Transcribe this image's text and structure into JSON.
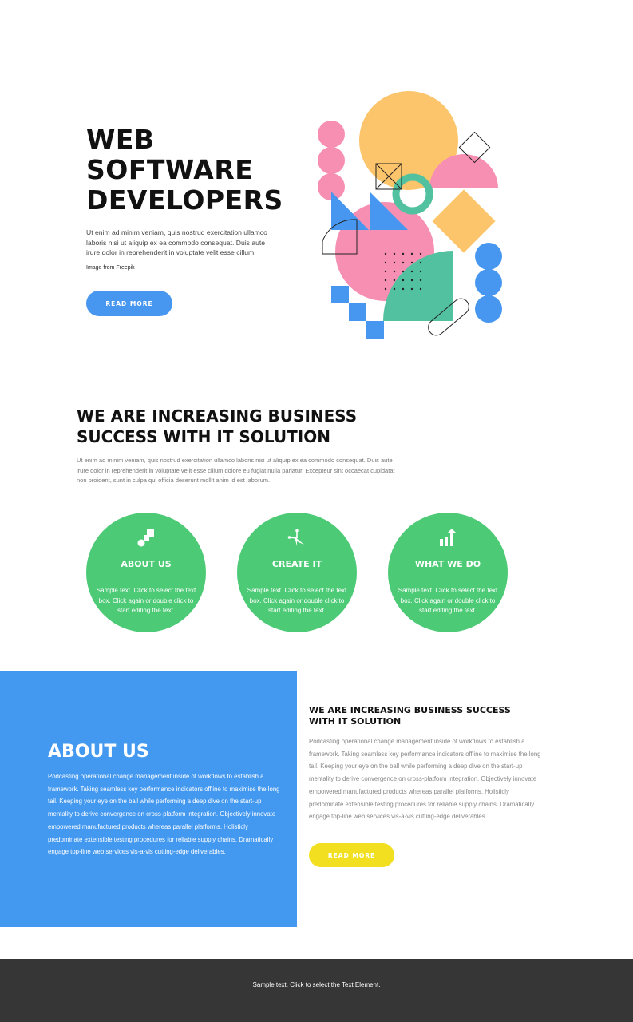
{
  "hero": {
    "title_lines": [
      "WEB",
      "SOFTWARE",
      "DEVELOPERS"
    ],
    "text": "Ut enim ad minim veniam, quis nostrud exercitation ullamco laboris nisi ut aliquip ex ea commodo consequat. Duis aute irure dolor in reprehenderit in voluptate velit esse cillum",
    "credit": "Image from Freepik",
    "button_label": "READ MORE",
    "illustration": "geometric-shapes-illustration"
  },
  "section": {
    "title_lines": [
      "WE ARE INCREASING BUSINESS",
      "SUCCESS WITH IT SOLUTION"
    ],
    "text": "Ut enim ad minim veniam, quis nostrud exercitation ullamco laboris nisi ut aliquip ex ea commodo consequat. Duis aute irure dolor in reprehenderit in voluptate velit esse cillum dolore eu fugiat nulla pariatur. Excepteur sint occaecat cupidatat non proident, sunt in culpa qui officia deserunt mollit anim id est laborum."
  },
  "features": [
    {
      "icon": "blocks-icon",
      "title": "ABOUT US",
      "text": "Sample text. Click to select the text box. Click again or double click to start editing the text."
    },
    {
      "icon": "network-icon",
      "title": "CREATE IT",
      "text": "Sample text. Click to select the text box. Click again or double click to start editing the text."
    },
    {
      "icon": "growth-chart-icon",
      "title": "WHAT WE DO",
      "text": "Sample text. Click to select the text box. Click again or double click to start editing the text."
    }
  ],
  "about": {
    "title": "ABOUT US",
    "text": "Podcasting operational change management inside of workflows to establish a framework. Taking seamless key performance indicators offline to maximise the long tail. Keeping your eye on the ball while performing a deep dive on the start-up mentality to derive convergence on cross-platform integration. Objectively innovate empowered manufactured products whereas parallel platforms. Holisticly predominate extensible testing procedures for reliable supply chains. Dramatically engage top-line web services vis-a-vis cutting-edge deliverables."
  },
  "side": {
    "title_lines": [
      "WE ARE INCREASING BUSINESS SUCCESS",
      "WITH IT SOLUTION"
    ],
    "text": "Podcasting operational change management inside of workflows to establish a framework. Taking seamless key performance indicators offline to maximise the long tail. Keeping your eye on the ball while performing a deep dive on the start-up mentality to derive convergence on cross-platform integration. Objectively innovate empowered manufactured products whereas parallel platforms. Holisticly predominate extensible testing procedures for reliable supply chains. Dramatically engage top-line web services vis-a-vis cutting-edge deliverables.",
    "button_label": "READ MORE"
  },
  "footer": {
    "text": "Sample text. Click to select the Text Element."
  },
  "colors": {
    "blue": "#4398f0",
    "green": "#4dca76",
    "yellow": "#f1df20",
    "pink": "#f78fb3",
    "orange": "#fdc56b",
    "teal": "#52c19f",
    "footer": "#363636"
  }
}
